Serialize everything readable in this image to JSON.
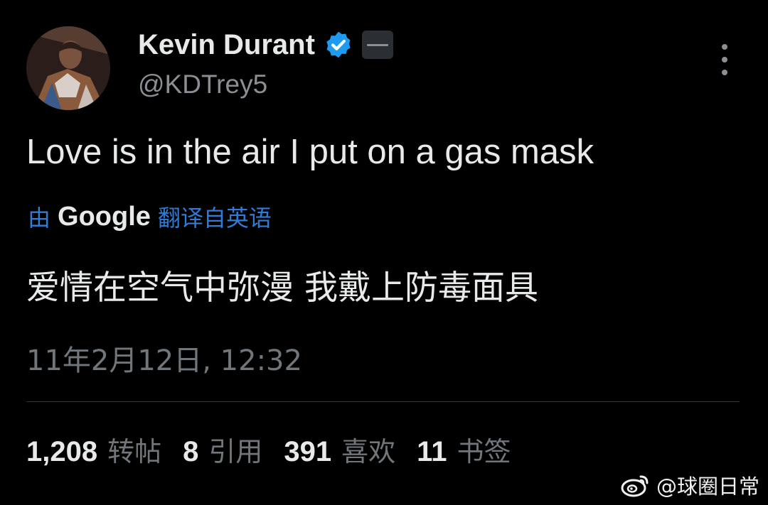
{
  "author": {
    "display_name": "Kevin Durant",
    "handle": "@KDTrey5"
  },
  "tweet": {
    "text": "Love is in the air I put on a gas mask",
    "translation_prefix": "由",
    "translation_provider": "Google",
    "translation_suffix": "翻译自英语",
    "translated_text": "爱情在空气中弥漫 我戴上防毒面具",
    "timestamp": "11年2月12日, 12:32"
  },
  "stats": [
    {
      "count": "1,208",
      "label": "转帖"
    },
    {
      "count": "8",
      "label": "引用"
    },
    {
      "count": "391",
      "label": "喜欢"
    },
    {
      "count": "11",
      "label": "书签"
    }
  ],
  "watermark": {
    "text": "@球圈日常",
    "logo_icon": "weibo-icon"
  },
  "icons": {
    "verified": "verified-badge-icon",
    "more": "more-options-icon"
  },
  "colors": {
    "background": "#000000",
    "primary_text": "#e7e9ea",
    "secondary_text": "#71767b",
    "link_blue": "#2f7bd6",
    "verified_blue": "#1d9bf0"
  }
}
